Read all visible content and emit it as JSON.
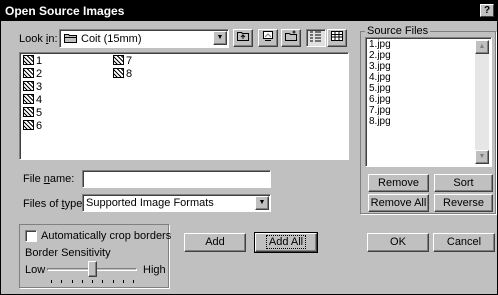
{
  "dialog": {
    "title": "Open Source Images",
    "help_label": "?"
  },
  "look_in": {
    "label_prefix": "Look ",
    "label_hotkey": "i",
    "label_suffix": "n:",
    "value": "Coit (15mm)",
    "icon": "folder-icon"
  },
  "toolbar": {
    "buttons": [
      {
        "name": "up-one-level",
        "icon": "folder-up-icon"
      },
      {
        "name": "desktop",
        "icon": "desktop-icon"
      },
      {
        "name": "new-folder",
        "icon": "new-folder-icon"
      },
      {
        "name": "list-view",
        "icon": "list-view-icon"
      },
      {
        "name": "details-view",
        "icon": "details-view-icon"
      }
    ]
  },
  "files": {
    "column1": [
      "1",
      "2",
      "3",
      "4",
      "5",
      "6"
    ],
    "column2": [
      "7",
      "8"
    ]
  },
  "file_name": {
    "label_prefix": "File ",
    "label_hotkey": "n",
    "label_suffix": "ame:",
    "value": ""
  },
  "file_type": {
    "label_prefix": "Files of ",
    "label_hotkey": "t",
    "label_suffix": "ype:",
    "value": "Supported Image Formats"
  },
  "source_files": {
    "label": "Source Files",
    "items": [
      "1.jpg",
      "2.jpg",
      "3.jpg",
      "4.jpg",
      "5.jpg",
      "6.jpg",
      "7.jpg",
      "8.jpg"
    ]
  },
  "source_buttons": {
    "remove": "Remove",
    "sort": "Sort",
    "remove_all": "Remove All",
    "reverse": "Reverse"
  },
  "crop": {
    "checkbox_label": "Automatically crop borders",
    "checked": false,
    "sensitivity_label": "Border Sensitivity",
    "low_label": "Low",
    "high_label": "High",
    "slider_level": 0.5,
    "tick_count": 9
  },
  "actions": {
    "add": "Add",
    "add_all": "Add All",
    "ok": "OK",
    "cancel": "Cancel"
  }
}
